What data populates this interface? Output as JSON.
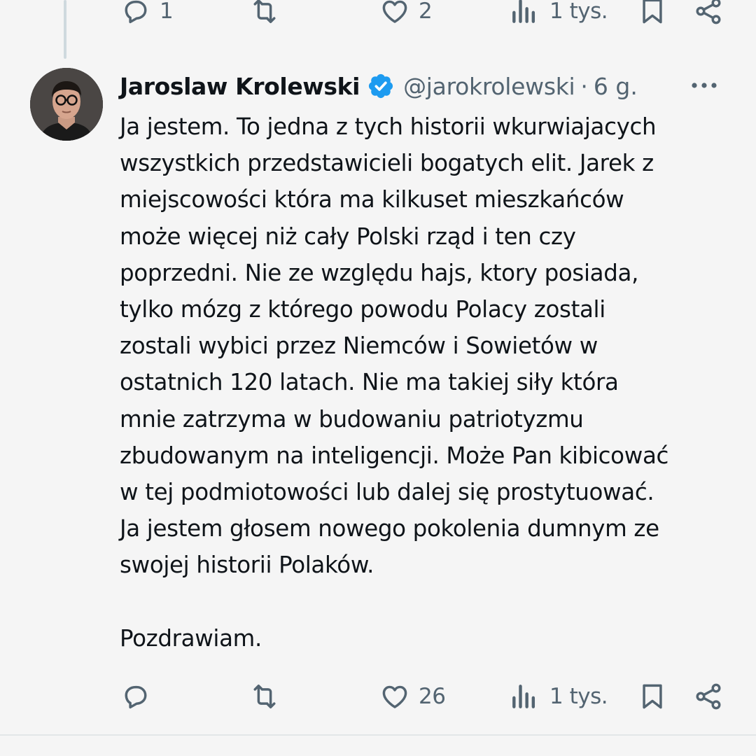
{
  "previous_tweet": {
    "actions": {
      "reply_count": "1",
      "retweet_count": "",
      "like_count": "2",
      "views_count": "1 tys."
    }
  },
  "tweet": {
    "author": {
      "name": "Jaroslaw Krolewski",
      "verified": true,
      "handle": "@jarokrolewski"
    },
    "separator": "·",
    "time": "6 g.",
    "body_lines": [
      "Ja jestem. To jedna z tych historii wkurwiajacych",
      "wszystkich przedstawicieli bogatych elit. Jarek z",
      "miejscowości która ma kilkuset mieszkańców",
      "może więcej niż cały Polski rząd i ten czy",
      "poprzedni. Nie ze względu hajs, ktory posiada,",
      "tylko mózg z którego powodu Polacy zostali",
      "zostali wybici przez Niemców i Sowietów w",
      "ostatnich 120 latach. Nie ma takiej siły która",
      "mnie zatrzyma w budowaniu patriotyzmu",
      "zbudowanym na inteligencji. Może Pan kibicować",
      "w tej podmiotowości lub dalej się prostytuować.",
      "Ja jestem głosem nowego pokolenia dumnym ze",
      "swojej historii Polaków."
    ],
    "closing": "Pozdrawiam.",
    "actions": {
      "reply_count": "",
      "retweet_count": "",
      "like_count": "26",
      "views_count": "1 tys."
    }
  },
  "icons": {
    "reply": "reply-icon",
    "retweet": "retweet-icon",
    "like": "heart-icon",
    "views": "views-icon",
    "bookmark": "bookmark-icon",
    "share": "share-icon",
    "verified": "verified-badge-icon",
    "more": "more-icon"
  },
  "colors": {
    "background": "#f5f5f5",
    "text_primary": "#0f1419",
    "text_secondary": "#536471",
    "verified_blue": "#1d9bf0",
    "thread_line": "#cfd9de"
  }
}
